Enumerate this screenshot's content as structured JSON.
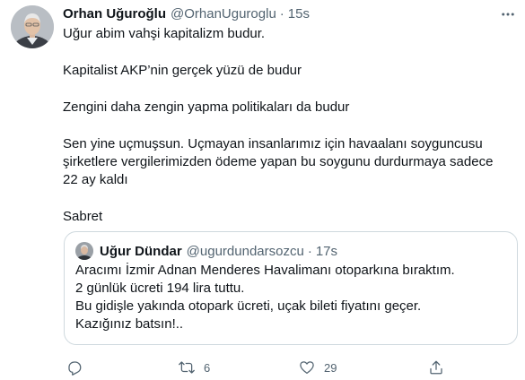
{
  "author": {
    "name": "Orhan Uğuroğlu",
    "handle": "@OrhanUguroglu",
    "separator": "·",
    "time": "15s"
  },
  "tweet": {
    "lines": [
      "Uğur abim vahşi kapitalizm budur.",
      "Kapitalist AKP’nin gerçek yüzü de budur",
      "Zengini daha zengin yapma politikaları da budur",
      "Sen yine uçmuşsun. Uçmayan insanlarımız için havaalanı soyguncusu şirketlere vergilerimizden ödeme yapan bu soygunu durdurmaya sadece 22 ay kaldı",
      "Sabret"
    ]
  },
  "quoted": {
    "name": "Uğur Dündar",
    "handle": "@ugurdundarsozcu",
    "separator": "·",
    "time": "17s",
    "lines": [
      "Aracımı İzmir Adnan Menderes Havalimanı otoparkına bıraktım.",
      "2 günlük ücreti 194 lira tuttu.",
      "Bu gidişle yakında otopark ücreti, uçak bileti fiyatını geçer.",
      "Kazığınız batsın!.."
    ]
  },
  "actions": {
    "reply_icon": "reply-icon",
    "retweet_icon": "retweet-icon",
    "retweet_count": "6",
    "like_icon": "heart-icon",
    "like_count": "29",
    "share_icon": "share-icon"
  },
  "colors": {
    "text": "#0f1419",
    "secondary": "#536471",
    "border": "#cfd9de"
  }
}
